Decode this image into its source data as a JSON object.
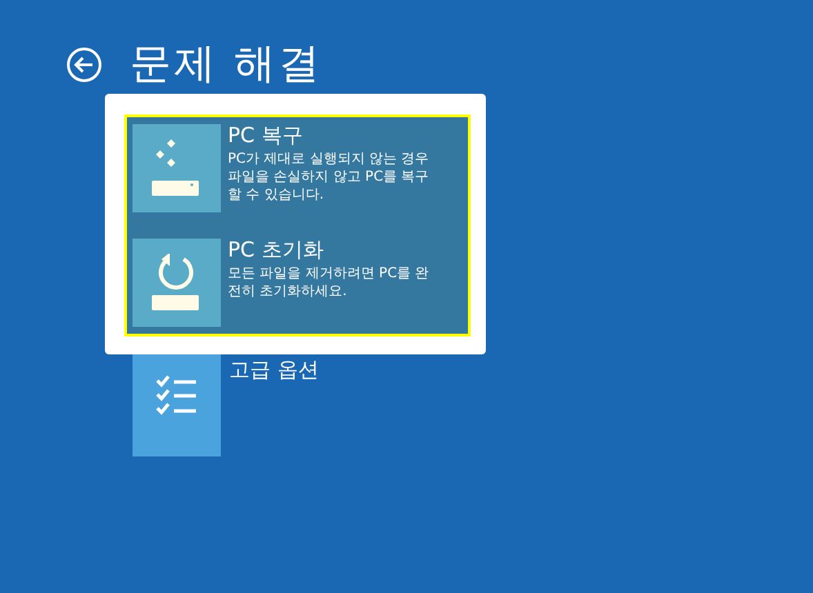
{
  "title": "문제 해결",
  "options": [
    {
      "kind": "advanced",
      "label": "고급 옵션"
    }
  ],
  "popup": {
    "items": [
      {
        "kind": "repair",
        "title": "PC 복구",
        "description": "PC가 제대로 실행되지 않는 경우 파일을 손실하지 않고 PC를 복구할 수 있습니다."
      },
      {
        "kind": "reset",
        "title": "PC 초기화",
        "description": "모든 파일을 제거하려면 PC를 완전히 초기화하세요."
      }
    ]
  }
}
